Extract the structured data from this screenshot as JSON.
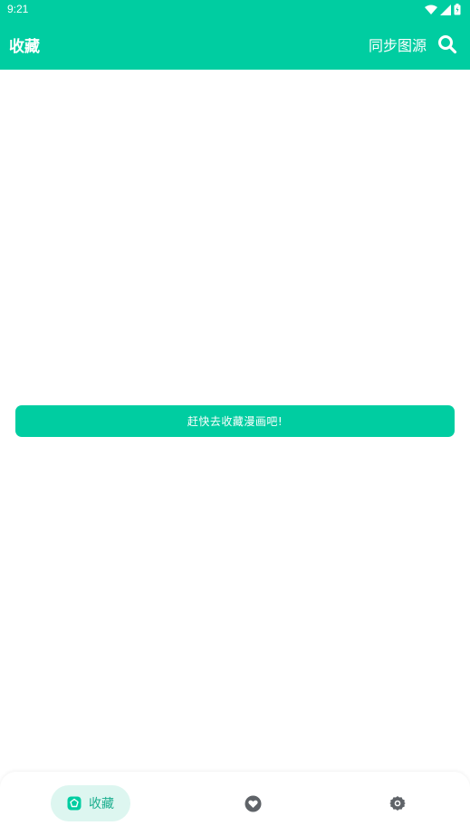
{
  "status_bar": {
    "time": "9:21",
    "icons": [
      "wifi-icon",
      "signal-icon",
      "battery-icon"
    ]
  },
  "app_bar": {
    "title": "收藏",
    "sync_label": "同步图源",
    "search_icon": "search-icon"
  },
  "main": {
    "empty_button_label": "赶快去收藏漫画吧!"
  },
  "bottom_nav": {
    "items": [
      {
        "label": "收藏",
        "icon": "favorites-icon",
        "selected": true
      },
      {
        "label": "",
        "icon": "heart-icon",
        "selected": false
      },
      {
        "label": "",
        "icon": "settings-icon",
        "selected": false
      }
    ]
  },
  "colors": {
    "accent": "#00CDA1",
    "nav_selected_bg": "#DDF6F0",
    "nav_selected_fg": "#1BAE8E",
    "nav_icon": "#5f6368"
  }
}
